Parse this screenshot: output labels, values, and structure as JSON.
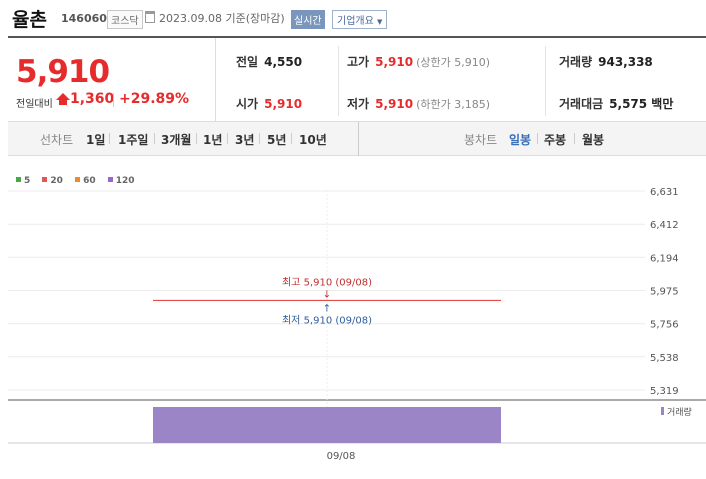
{
  "header": {
    "name": "율촌",
    "code": "146060",
    "market": "코스닥",
    "date": "2023.09.08 기준(장마감)",
    "realtime": "실시간",
    "company_info": "기업개요"
  },
  "price": {
    "current": "5,910",
    "change_label": "전일대비",
    "change": "1,360",
    "change_rate": "+29.89%"
  },
  "stats": {
    "prev_label": "전일",
    "prev": "4,550",
    "open_label": "시가",
    "open": "5,910",
    "high_label": "고가",
    "high": "5,910",
    "upper_limit": "(상한가 5,910)",
    "low_label": "저가",
    "low": "5,910",
    "lower_limit": "(하한가 3,185)",
    "volume_label": "거래량",
    "volume": "943,338",
    "amount_label": "거래대금",
    "amount": "5,575 백만"
  },
  "tabs": {
    "line_label": "선차트",
    "line_periods": [
      "1일",
      "1주일",
      "3개월",
      "1년",
      "3년",
      "5년",
      "10년"
    ],
    "candle_label": "봉차트",
    "candle_periods": [
      "일봉",
      "주봉",
      "월봉"
    ],
    "active_candle": "일봉"
  },
  "colors": {
    "up": "#e52b2b",
    "accent": "#3a6fb8",
    "volume": "#9b85c6"
  },
  "chart_data": {
    "type": "bar",
    "legend": [
      {
        "name": "5",
        "color": "#44aa44"
      },
      {
        "name": "20",
        "color": "#e55555"
      },
      {
        "name": "60",
        "color": "#f08a24"
      },
      {
        "name": "120",
        "color": "#9966cc"
      }
    ],
    "y_ticks": [
      "6,631",
      "6,412",
      "6,194",
      "5,975",
      "5,756",
      "5,538",
      "5,319"
    ],
    "ylim": [
      5319,
      6631
    ],
    "x_labels": [
      "09/08"
    ],
    "candles": [
      {
        "date": "09/08",
        "open": 5910,
        "high": 5910,
        "low": 5910,
        "close": 5910,
        "volume": 943338
      }
    ],
    "annotations": {
      "high": "최고 5,910 (09/08)",
      "low": "최저 5,910 (09/08)"
    },
    "volume_label": "거래량"
  }
}
